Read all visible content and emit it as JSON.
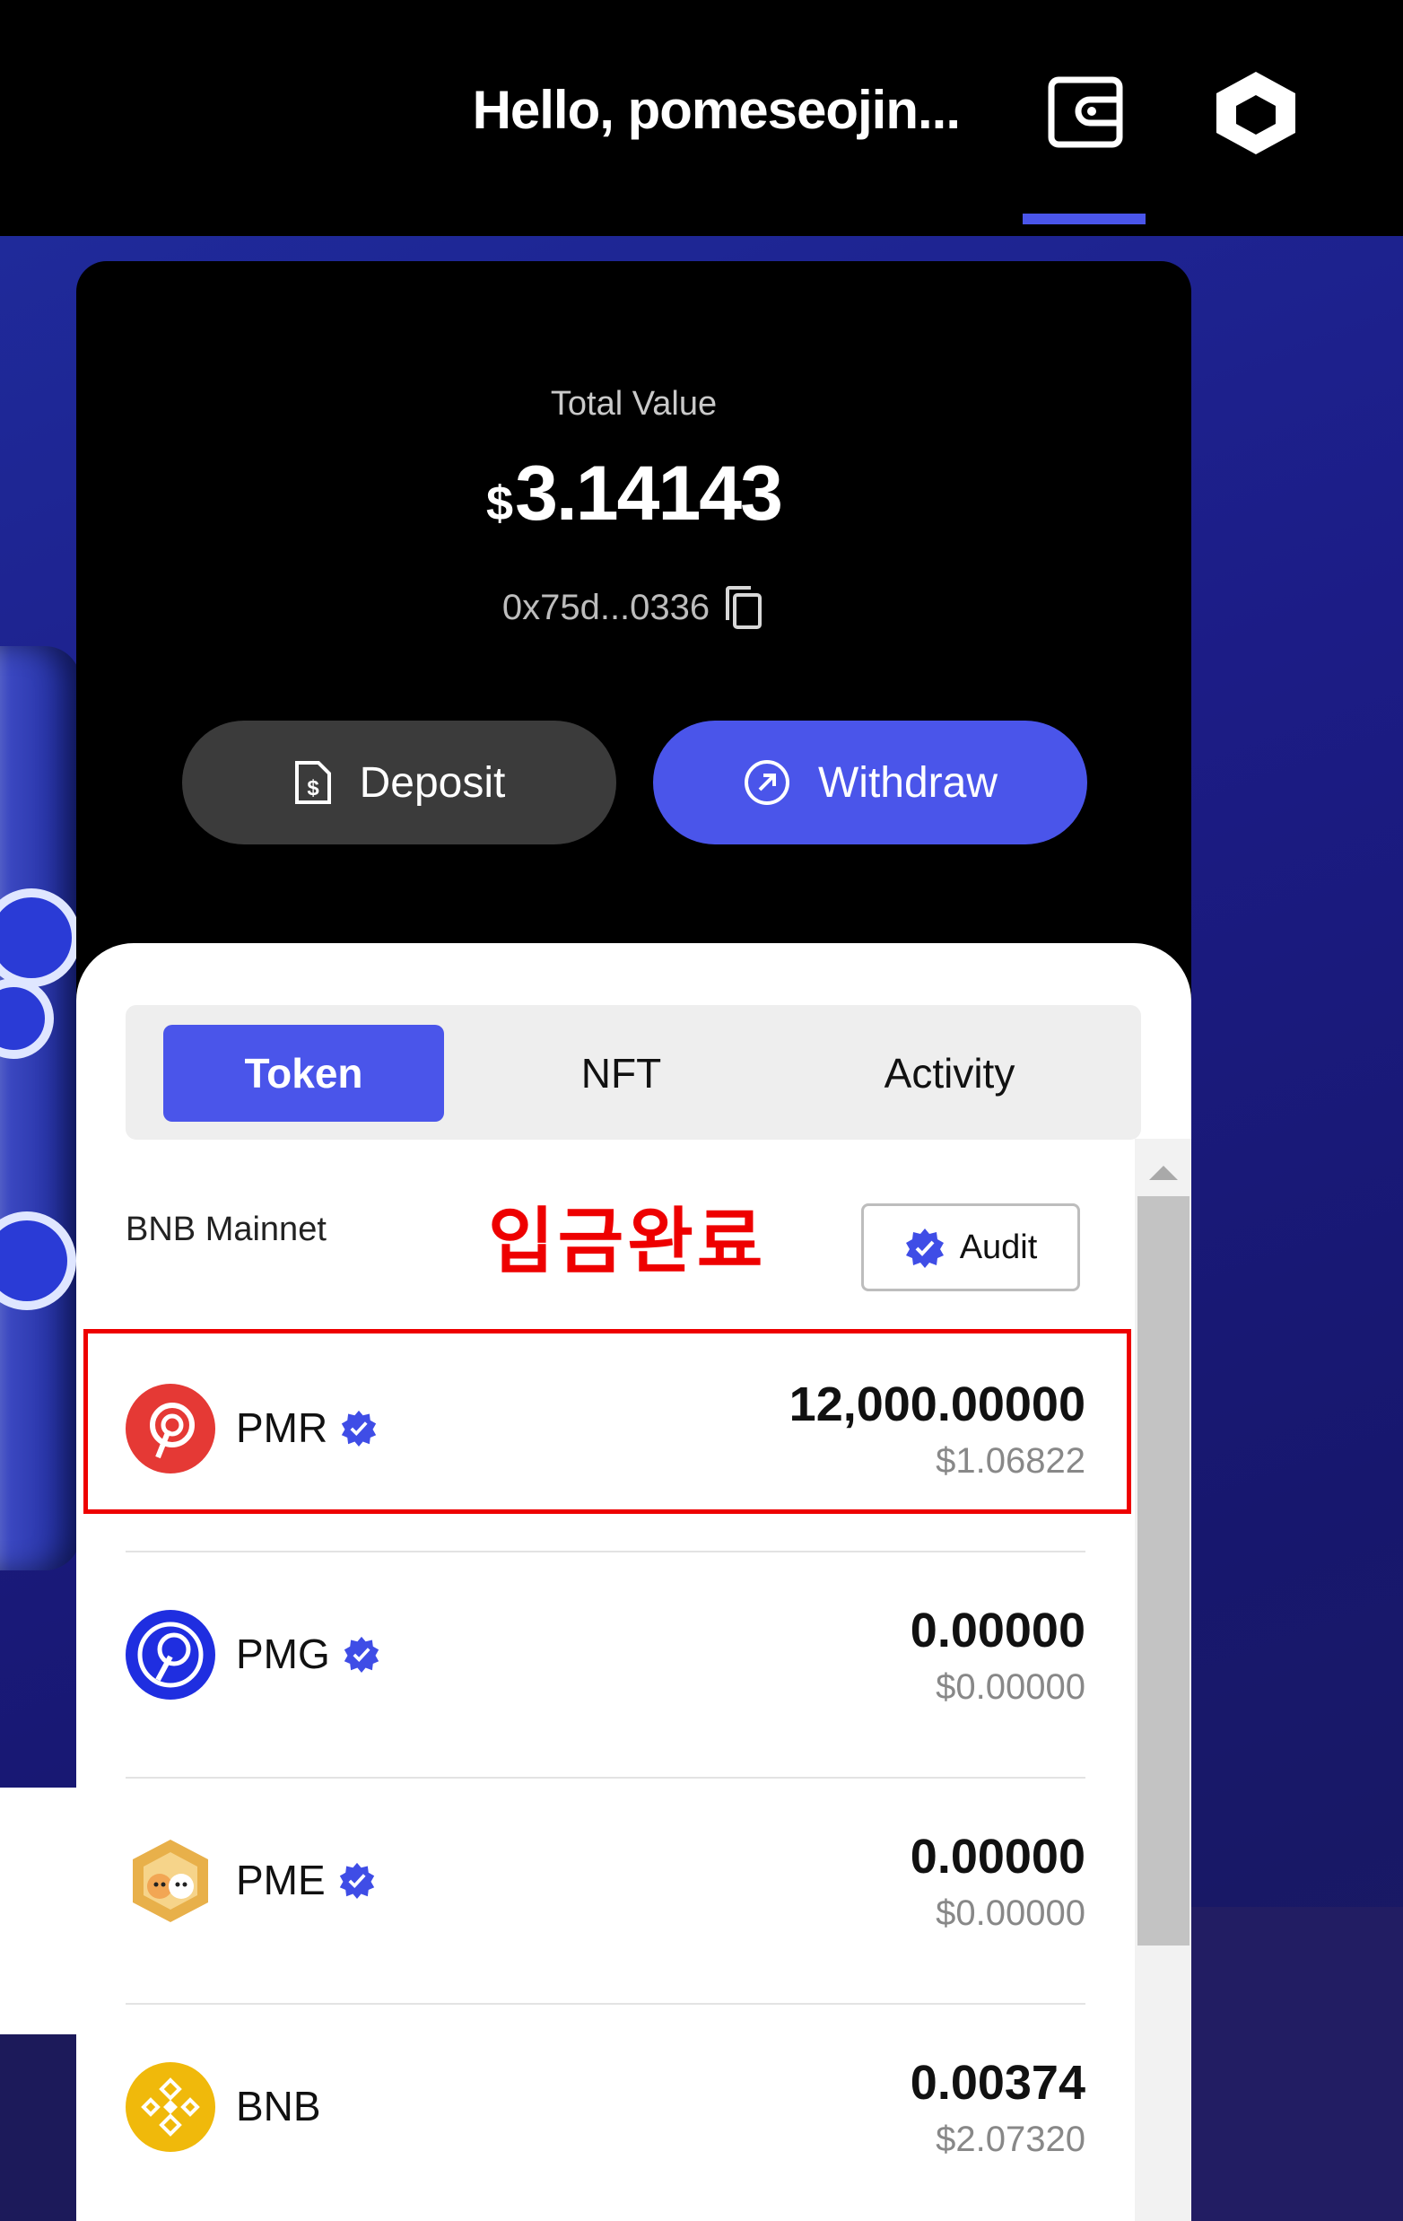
{
  "header": {
    "greeting": "Hello, pomeseojin..."
  },
  "wallet": {
    "total_label": "Total Value",
    "currency_symbol": "$",
    "total_value": "3.14143",
    "address": "0x75d...0336",
    "deposit_label": "Deposit",
    "withdraw_label": "Withdraw"
  },
  "tabs": [
    {
      "label": "Token",
      "active": true
    },
    {
      "label": "NFT",
      "active": false
    },
    {
      "label": "Activity",
      "active": false
    }
  ],
  "network": "BNB Mainnet",
  "notice": "입금완료",
  "audit_label": "Audit",
  "tokens": [
    {
      "symbol": "PMR",
      "verified": true,
      "amount": "12,000.00000",
      "usd": "$1.06822",
      "icon": "pmr-icon",
      "color": "#e53935"
    },
    {
      "symbol": "PMG",
      "verified": true,
      "amount": "0.00000",
      "usd": "$0.00000",
      "icon": "pmg-icon",
      "color": "#1f2ee0"
    },
    {
      "symbol": "PME",
      "verified": true,
      "amount": "0.00000",
      "usd": "$0.00000",
      "icon": "pme-icon",
      "color": "#e0a23a"
    },
    {
      "symbol": "BNB",
      "verified": false,
      "amount": "0.00374",
      "usd": "$2.07320",
      "icon": "bnb-icon",
      "color": "#f0b90b"
    }
  ],
  "colors": {
    "accent": "#4a55ea",
    "highlight": "#ee0000"
  }
}
